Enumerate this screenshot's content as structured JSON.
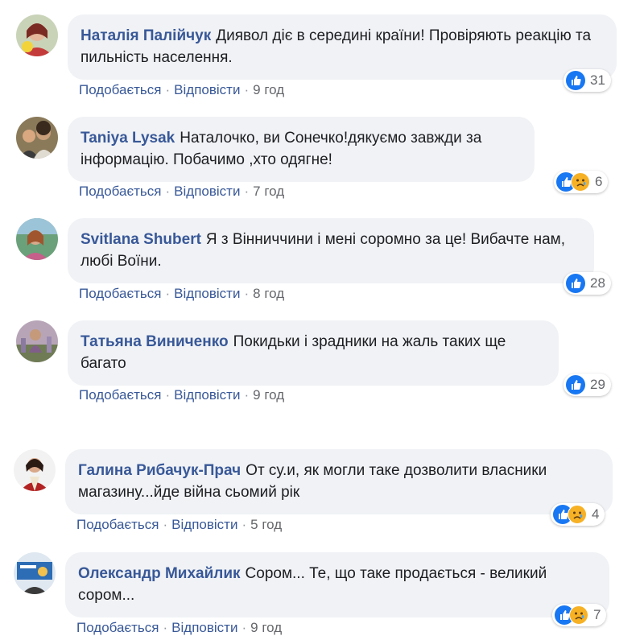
{
  "actions": {
    "like": "Подобається",
    "reply": "Відповісти",
    "sep": "·"
  },
  "colors": {
    "name": "#385898",
    "bubble": "#f0f2f5",
    "like": "#1877f2",
    "sad": "#f7b125"
  },
  "comments": [
    {
      "author": "Наталія Палійчук",
      "text": "Диявол діє в середині країни! Провіряють реакцію та пильність населення.",
      "time": "9 год",
      "reactions": [
        "like"
      ],
      "count": "31"
    },
    {
      "author": "Taniya Lysak",
      "text": "Наталочко, ви Сонечко!дякуємо завжди за інформацію. Побачимо ,хто одягне!",
      "time": "7 год",
      "reactions": [
        "like",
        "sad"
      ],
      "count": "6"
    },
    {
      "author": "Svitlana Shubert",
      "text": "Я з Вінниччини і мені соромно за це! Вибачте нам, любі Воїни.",
      "time": "8 год",
      "reactions": [
        "like"
      ],
      "count": "28"
    },
    {
      "author": "Татьяна Виниченко",
      "text": "Покидьки і зрадники на жаль таких ще багато",
      "time": "9 год",
      "reactions": [
        "like"
      ],
      "count": "29"
    },
    {
      "author": "Галина Рибачук-Прач",
      "text": "От су.и, як могли таке дозволити власники магазину...йде війна сьомий рік",
      "time": "5 год",
      "reactions": [
        "like",
        "sad"
      ],
      "count": "4"
    },
    {
      "author": "Олександр Михайлик",
      "text": "Сором... Те, що таке продається - великий сором...",
      "time": "9 год",
      "reactions": [
        "like",
        "sad"
      ],
      "count": "7"
    }
  ]
}
